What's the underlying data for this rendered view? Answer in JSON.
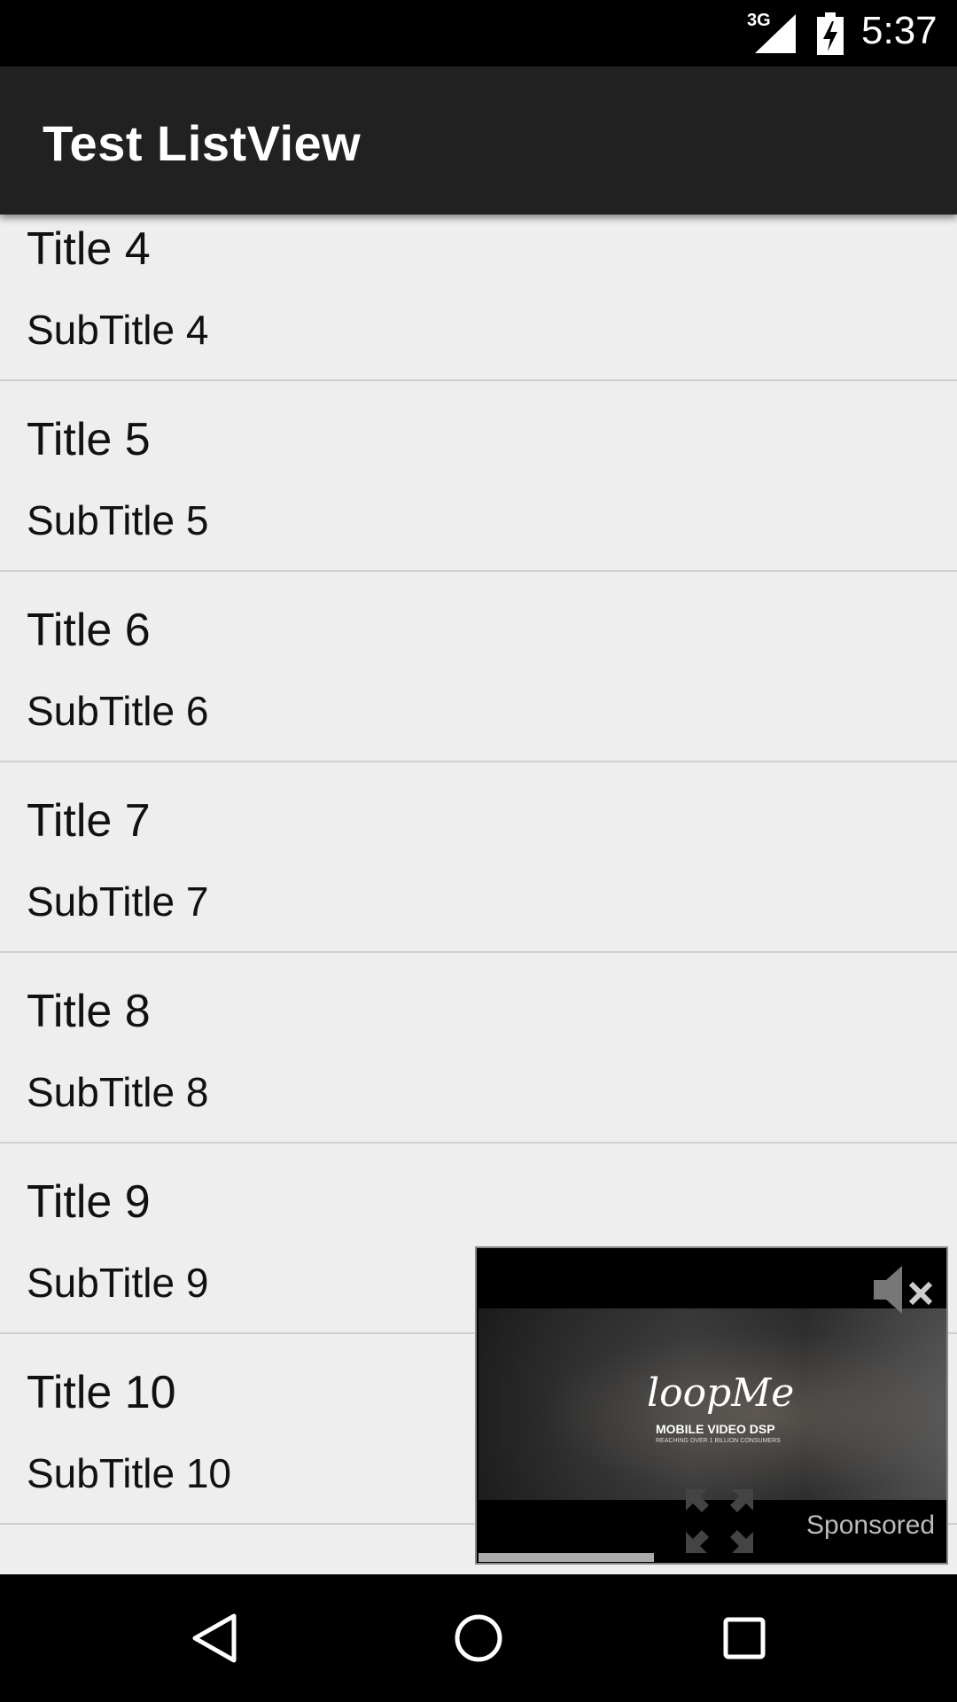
{
  "status_bar": {
    "network": "3G",
    "time": "5:37"
  },
  "app_bar": {
    "title": "Test ListView"
  },
  "list": {
    "items": [
      {
        "title": "Title 4",
        "subtitle": "SubTitle 4"
      },
      {
        "title": "Title 5",
        "subtitle": "SubTitle 5"
      },
      {
        "title": "Title 6",
        "subtitle": "SubTitle 6"
      },
      {
        "title": "Title 7",
        "subtitle": "SubTitle 7"
      },
      {
        "title": "Title 8",
        "subtitle": "SubTitle 8"
      },
      {
        "title": "Title 9",
        "subtitle": "SubTitle 9"
      },
      {
        "title": "Title 10",
        "subtitle": "SubTitle 10"
      }
    ]
  },
  "ad": {
    "logo": "loopMe",
    "tagline": "MOBILE VIDEO DSP",
    "tagline2": "REACHING OVER 1 BILLION CONSUMERS",
    "sponsored": "Sponsored",
    "progress": 0.37
  },
  "colors": {
    "app_bar": "#212121",
    "list_bg": "#eeeeee",
    "divider": "#cfcfcf"
  }
}
